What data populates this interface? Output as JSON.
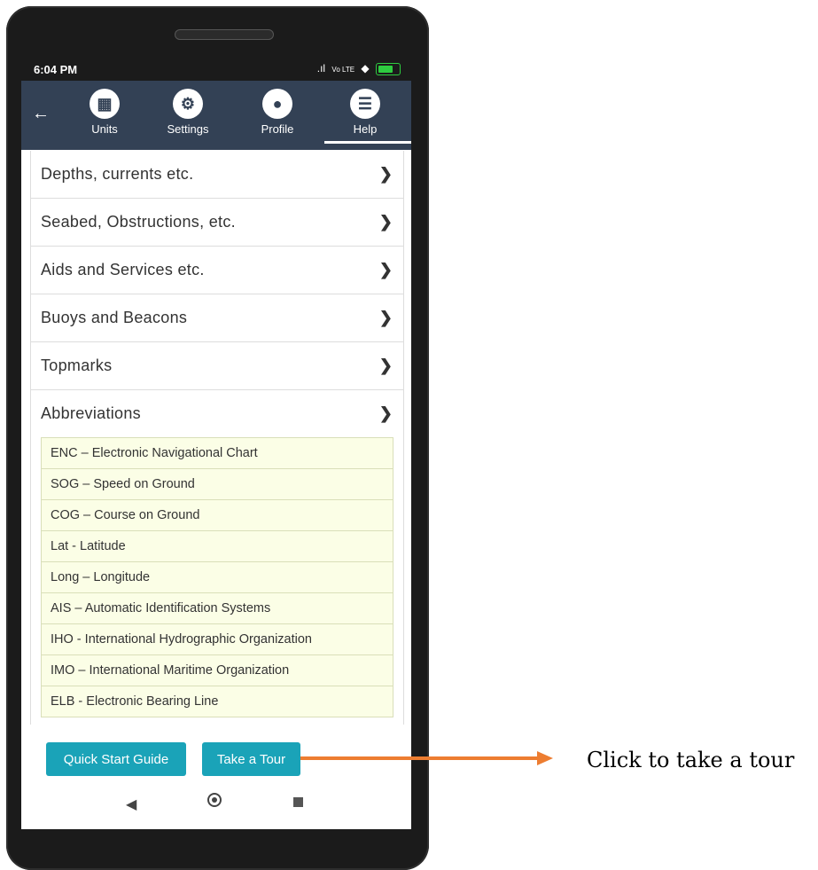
{
  "status": {
    "time": "6:04 PM",
    "signal": ".ıl",
    "network": "Vo LTE",
    "wifi": "◆"
  },
  "nav": {
    "back_icon": "arrow-left-icon",
    "items": [
      {
        "label": "Units",
        "icon": "chart-icon"
      },
      {
        "label": "Settings",
        "icon": "gear-icon"
      },
      {
        "label": "Profile",
        "icon": "user-icon"
      },
      {
        "label": "Help",
        "icon": "list-icon",
        "active": true
      }
    ]
  },
  "sections": [
    {
      "title": "Depths, currents etc."
    },
    {
      "title": "Seabed, Obstructions, etc."
    },
    {
      "title": "Aids and Services etc."
    },
    {
      "title": "Buoys and Beacons"
    },
    {
      "title": "Topmarks"
    },
    {
      "title": "Abbreviations"
    }
  ],
  "abbreviations": [
    "ENC – Electronic Navigational Chart",
    "SOG – Speed on Ground",
    "COG – Course on Ground",
    "Lat - Latitude",
    "Long – Longitude",
    "AIS – Automatic Identification Systems",
    "IHO - International Hydrographic Organization",
    "IMO – International Maritime Organization",
    "ELB - Electronic Bearing Line"
  ],
  "buttons": {
    "guide": "Quick Start Guide",
    "tour": "Take a Tour"
  },
  "annotation": {
    "text": "Click to take a tour",
    "color": "#ed7d31"
  },
  "colors": {
    "navbar": "#334155",
    "button": "#1aa3b8",
    "abbr_bg": "#fbfee6"
  }
}
